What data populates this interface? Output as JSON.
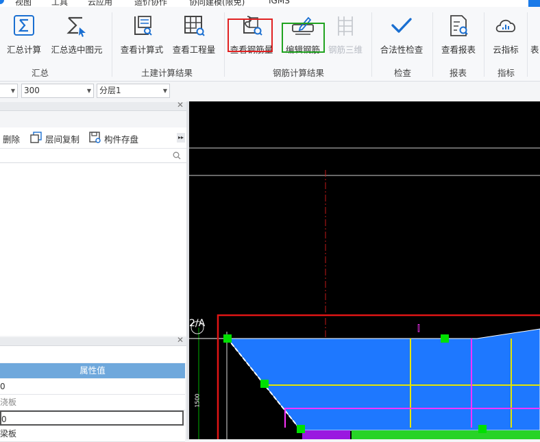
{
  "menu": {
    "items": [
      "视图",
      "工具",
      "云应用",
      "造价协作",
      "协同建模(限免)",
      "IGMS"
    ]
  },
  "ribbon": {
    "buttons": {
      "sum_calc": "汇总计算",
      "sum_selected": "汇总选中图元",
      "view_formula": "查看计算式",
      "view_quantity": "查看工程量",
      "view_rebar_qty": "查看钢筋量",
      "edit_rebar": "编辑钢筋",
      "rebar_3d": "钢筋三维",
      "legality_check": "合法性检查",
      "view_report": "查看报表",
      "cloud_index": "云指标",
      "cut": "表"
    },
    "groups": {
      "summary": "汇总",
      "civil_results": "土建计算结果",
      "rebar_results": "钢筋计算结果",
      "check": "检查",
      "report": "报表",
      "index": "指标"
    }
  },
  "toolbar2": {
    "value1": "300",
    "floor": "分层1"
  },
  "side_panel": {
    "delete": "删除",
    "copy_floor": "层间复制",
    "save_component": "构件存盘",
    "more": "▸▸"
  },
  "properties": {
    "header": "属性值",
    "rows": [
      "0",
      "浇板",
      "0",
      "梁板"
    ]
  },
  "canvas": {
    "axis_label": "2/A",
    "dimension": "1500",
    "colors": {
      "fill_blue": "#1e78ff",
      "handle_green": "#00e000",
      "magenta": "#ff33ff",
      "yellow": "#e6e600",
      "frame_red": "#e01515"
    }
  },
  "colors": {
    "accent_blue": "#1a7ae8",
    "highlight_red": "#e02020",
    "highlight_green": "#1fa31f",
    "prop_header": "#6fa8dc"
  }
}
